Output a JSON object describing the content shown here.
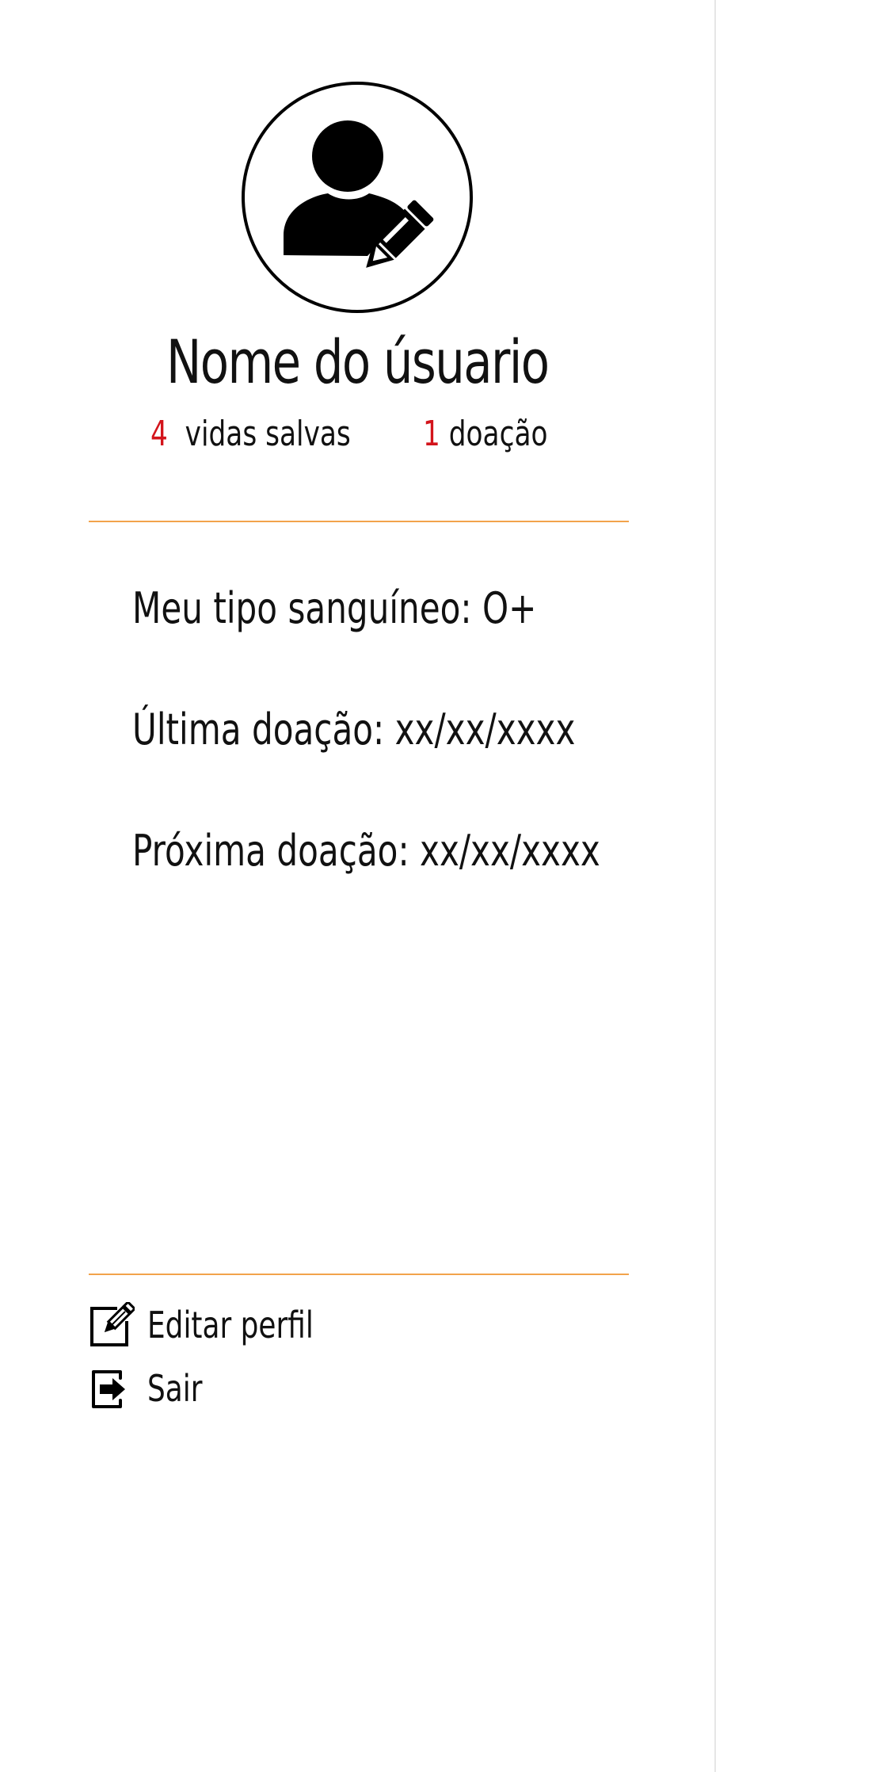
{
  "profile": {
    "username": "Nome do úsuario",
    "avatar_icon": "user-edit-icon"
  },
  "stats": {
    "lives_saved_count": "4",
    "lives_saved_label": "vidas salvas",
    "donations_count": "1",
    "donations_label": "doação",
    "highlight_color": "#d3141b"
  },
  "info": {
    "blood_type_text": "Meu tipo sanguíneo: O+",
    "last_donation_text": "Última doação: xx/xx/xxxx",
    "next_donation_text": "Próxima doação: xx/xx/xxxx"
  },
  "menu": {
    "edit_profile_label": "Editar perfil",
    "edit_profile_icon": "edit-square-icon",
    "logout_label": "Sair",
    "logout_icon": "sign-out-icon"
  },
  "colors": {
    "divider": "#f2a34b",
    "text": "#111111",
    "panel_border": "#e6e6e6"
  }
}
